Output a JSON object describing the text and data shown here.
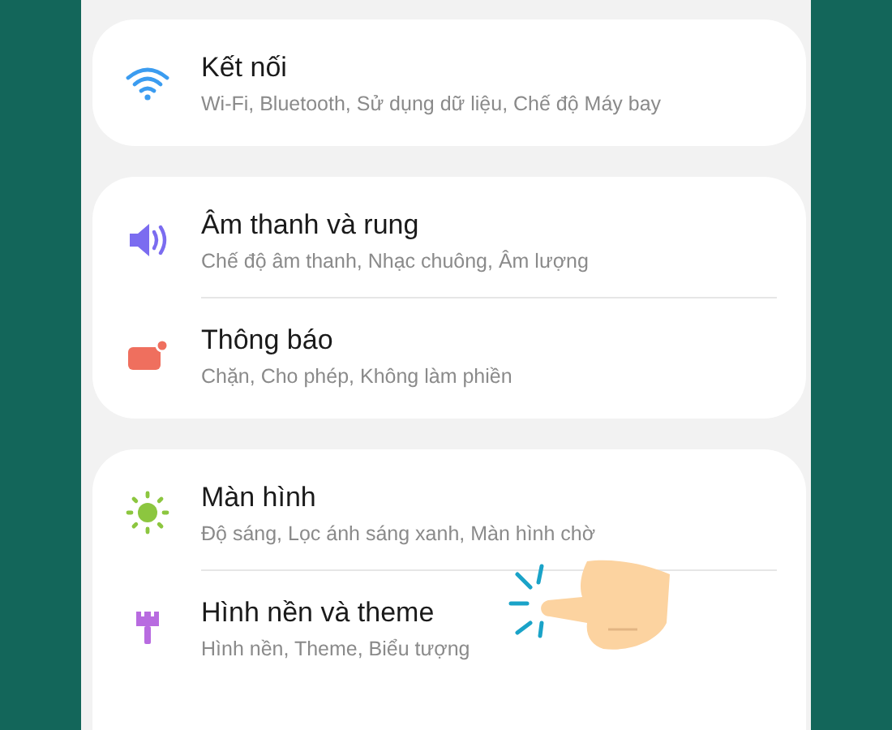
{
  "groups": [
    {
      "items": [
        {
          "kind": "wifi",
          "title": "Kết nối",
          "subtitle": "Wi-Fi, Bluetooth, Sử dụng dữ liệu, Chế độ Máy bay"
        }
      ]
    },
    {
      "items": [
        {
          "kind": "sound",
          "title": "Âm thanh và rung",
          "subtitle": "Chế độ âm thanh, Nhạc chuông, Âm lượng"
        },
        {
          "kind": "notification",
          "title": "Thông báo",
          "subtitle": "Chặn, Cho phép, Không làm phiền"
        }
      ]
    },
    {
      "items": [
        {
          "kind": "display",
          "title": "Màn hình",
          "subtitle": "Độ sáng, Lọc ánh sáng xanh, Màn hình chờ"
        },
        {
          "kind": "brush",
          "title": "Hình nền và theme",
          "subtitle": "Hình nền, Theme, Biểu tượng",
          "tapped": true
        }
      ]
    }
  ]
}
